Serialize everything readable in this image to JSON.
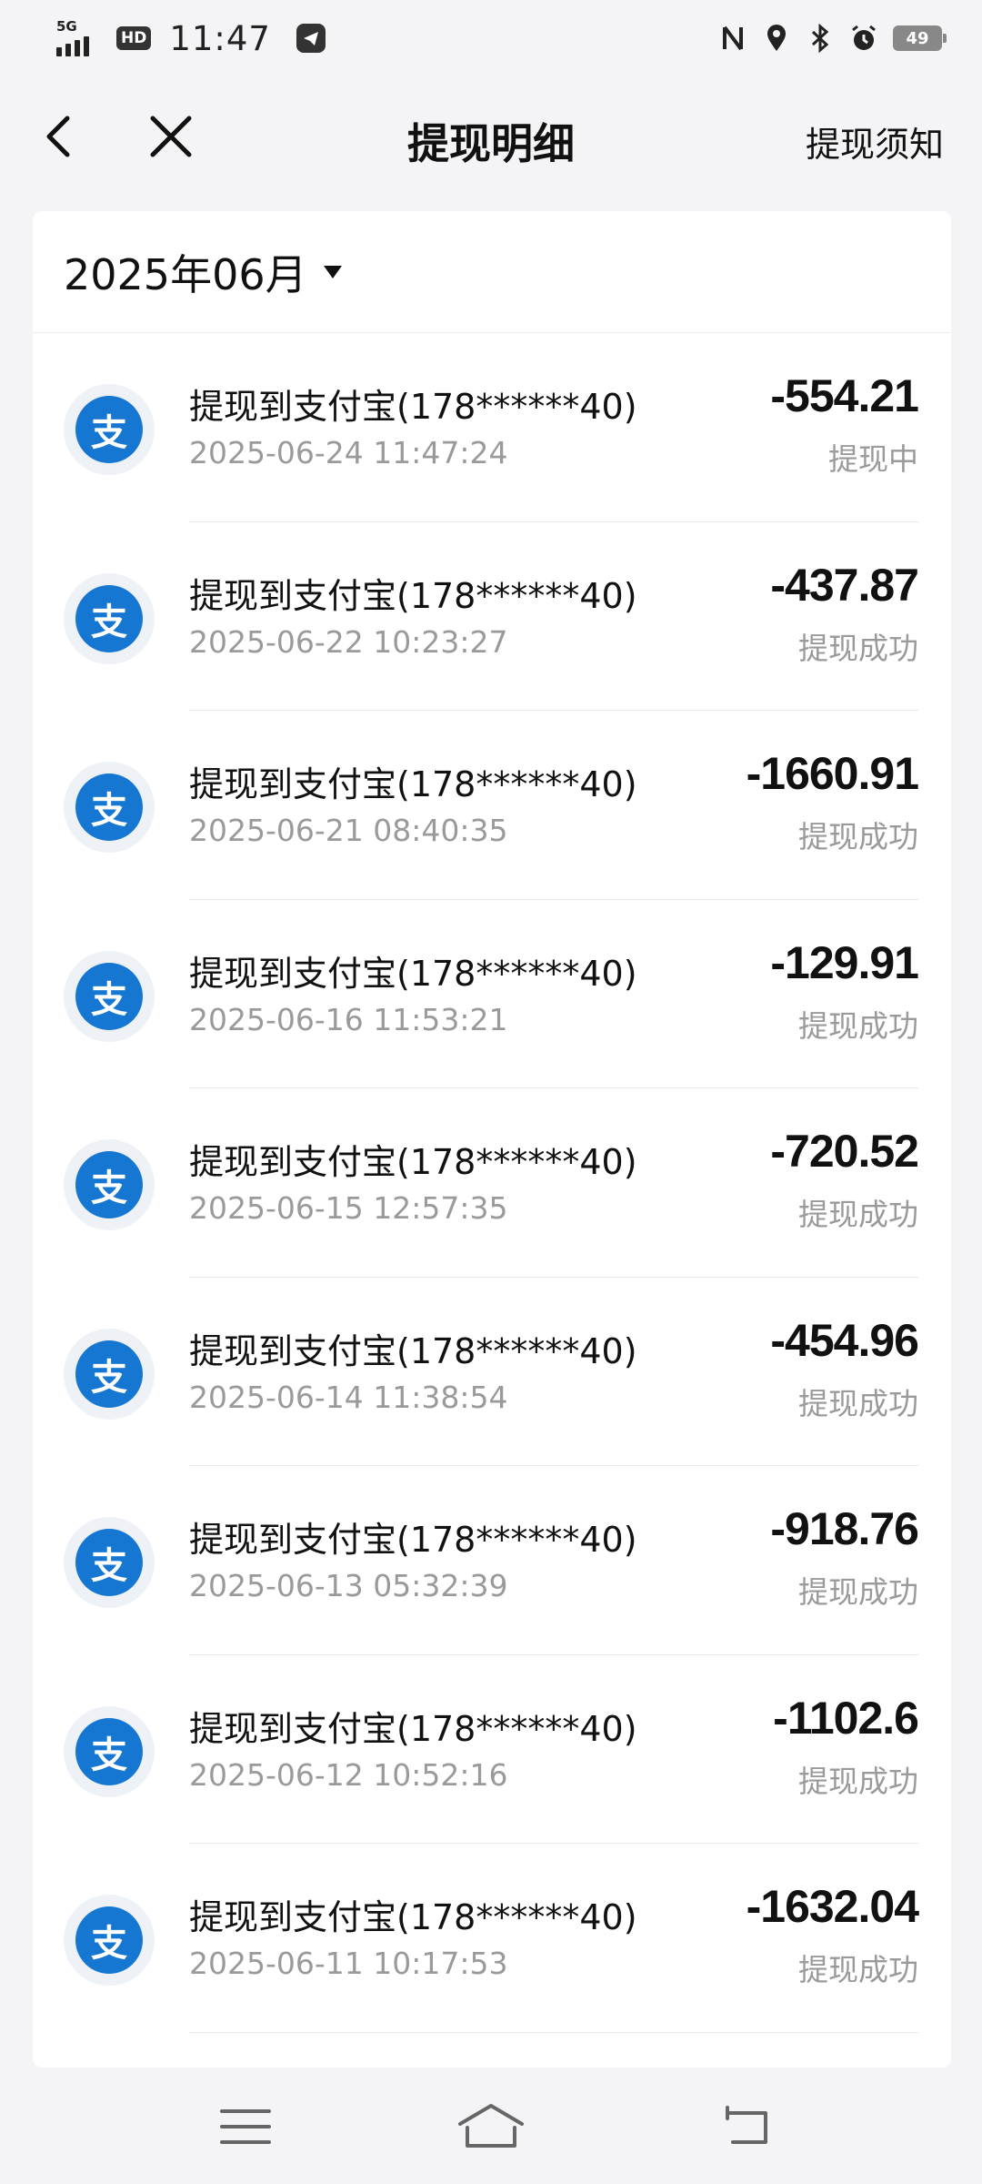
{
  "status_bar": {
    "network": "5G",
    "hd": "HD",
    "time": "11:47",
    "battery": "49"
  },
  "nav": {
    "title": "提现明细",
    "notice": "提现须知"
  },
  "filter": {
    "month": "2025年06月"
  },
  "records": [
    {
      "title": "提现到支付宝(178******40)",
      "time": "2025-06-24 11:47:24",
      "amount": "-554.21",
      "status": "提现中"
    },
    {
      "title": "提现到支付宝(178******40)",
      "time": "2025-06-22 10:23:27",
      "amount": "-437.87",
      "status": "提现成功"
    },
    {
      "title": "提现到支付宝(178******40)",
      "time": "2025-06-21 08:40:35",
      "amount": "-1660.91",
      "status": "提现成功"
    },
    {
      "title": "提现到支付宝(178******40)",
      "time": "2025-06-16 11:53:21",
      "amount": "-129.91",
      "status": "提现成功"
    },
    {
      "title": "提现到支付宝(178******40)",
      "time": "2025-06-15 12:57:35",
      "amount": "-720.52",
      "status": "提现成功"
    },
    {
      "title": "提现到支付宝(178******40)",
      "time": "2025-06-14 11:38:54",
      "amount": "-454.96",
      "status": "提现成功"
    },
    {
      "title": "提现到支付宝(178******40)",
      "time": "2025-06-13 05:32:39",
      "amount": "-918.76",
      "status": "提现成功"
    },
    {
      "title": "提现到支付宝(178******40)",
      "time": "2025-06-12 10:52:16",
      "amount": "-1102.6",
      "status": "提现成功"
    },
    {
      "title": "提现到支付宝(178******40)",
      "time": "2025-06-11 10:17:53",
      "amount": "-1632.04",
      "status": "提现成功"
    }
  ],
  "icons": {
    "alipay_glyph": "支",
    "alipay_color": "#1677d2"
  }
}
